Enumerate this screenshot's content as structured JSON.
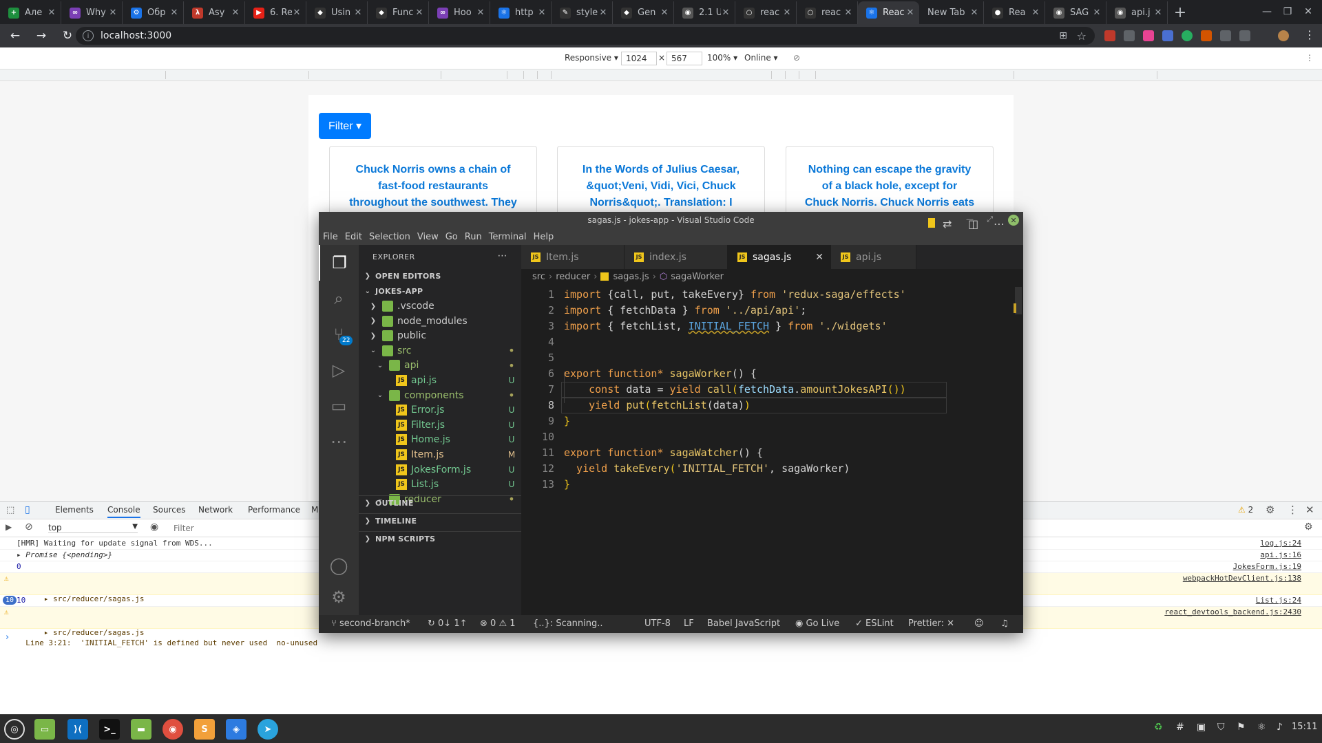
{
  "browser": {
    "tabs": [
      {
        "title": "Але",
        "color": "#1e8e3e",
        "glyph": "+"
      },
      {
        "title": "Why",
        "color": "#7b3fb5",
        "glyph": "∞"
      },
      {
        "title": "Обр",
        "color": "#1a73e8",
        "glyph": "⚙"
      },
      {
        "title": "Asy",
        "color": "#c0392b",
        "glyph": "λ"
      },
      {
        "title": "6. Re",
        "color": "#e62117",
        "glyph": "▶"
      },
      {
        "title": "Usin",
        "color": "#333",
        "glyph": "◆"
      },
      {
        "title": "Func",
        "color": "#333",
        "glyph": "◆"
      },
      {
        "title": "Hoo",
        "color": "#7b3fb5",
        "glyph": "∞"
      },
      {
        "title": "http",
        "color": "#1a73e8",
        "glyph": "⚛"
      },
      {
        "title": "style",
        "color": "#333",
        "glyph": "✎"
      },
      {
        "title": "Gen",
        "color": "#333",
        "glyph": "◆"
      },
      {
        "title": "2.1 U",
        "color": "#555",
        "glyph": "◉"
      },
      {
        "title": "reac",
        "color": "#333",
        "glyph": "○"
      },
      {
        "title": "reac",
        "color": "#333",
        "glyph": "○"
      },
      {
        "title": "Reac",
        "color": "#1a73e8",
        "glyph": "⚛",
        "active": true
      },
      {
        "title": "New Tab",
        "color": "",
        "glyph": ""
      },
      {
        "title": "Rea",
        "color": "#333",
        "glyph": "●"
      },
      {
        "title": "SAG",
        "color": "#555",
        "glyph": "◉"
      },
      {
        "title": "api.j",
        "color": "#555",
        "glyph": "◉"
      }
    ],
    "url": "localhost:3000"
  },
  "device_toolbar": {
    "mode": "Responsive",
    "width": "1024",
    "height": "567",
    "zoom": "100%",
    "throttle": "Online"
  },
  "page": {
    "filter_label": "Filter",
    "jokes": [
      "Chuck Norris owns a chain of fast-food restaurants throughout the southwest. They",
      "In the Words of Julius Caesar, &quot;Veni, Vidi, Vici, Chuck Norris&quot;. Translation: I",
      "Nothing can escape the gravity of a black hole, except for Chuck Norris. Chuck Norris eats"
    ]
  },
  "devtools": {
    "tabs": [
      "Elements",
      "Console",
      "Sources",
      "Network",
      "Performance",
      "M"
    ],
    "active_tab": "Console",
    "context": "top",
    "filter_placeholder": "Filter",
    "warning_count": "2",
    "console": [
      {
        "text": "[HMR] Waiting for update signal from WDS...",
        "source": "log.js:24",
        "type": "log"
      },
      {
        "text": "▸ Promise {<pending>}",
        "source": "api.js:16",
        "type": "log"
      },
      {
        "text": "0",
        "source": "JokesForm.js:19",
        "type": "num"
      },
      {
        "text": "▸ src/reducer/sagas.js\n  Line 3:21:  'INITIAL_FETCH' is defined but never used  no-unused",
        "source": "webpackHotDevClient.js:138",
        "type": "warn"
      },
      {
        "text": "10",
        "source": "List.js:24",
        "type": "count",
        "count": "10"
      },
      {
        "text": "▸ src/reducer/sagas.js\n  Line 3:21:  'INITIAL_FETCH' is defined but never used  no-unused",
        "source": "react_devtools_backend.js:2430",
        "type": "warn"
      }
    ]
  },
  "vscode": {
    "title": "sagas.js - jokes-app - Visual Studio Code",
    "menu": [
      "File",
      "Edit",
      "Selection",
      "View",
      "Go",
      "Run",
      "Terminal",
      "Help"
    ],
    "scm_badge": "22",
    "explorer_label": "EXPLORER",
    "sections": {
      "open_editors": "OPEN EDITORS",
      "project": "JOKES-APP",
      "outline": "OUTLINE",
      "timeline": "TIMELINE",
      "npm": "NPM SCRIPTS"
    },
    "tree": [
      {
        "name": ".vscode",
        "depth": 1,
        "kind": "folder",
        "open": false,
        "status": ""
      },
      {
        "name": "node_modules",
        "depth": 1,
        "kind": "folder",
        "open": false,
        "status": ""
      },
      {
        "name": "public",
        "depth": 1,
        "kind": "folder",
        "open": false,
        "status": ""
      },
      {
        "name": "src",
        "depth": 1,
        "kind": "folder",
        "open": true,
        "status": "•"
      },
      {
        "name": "api",
        "depth": 2,
        "kind": "folder",
        "open": true,
        "status": "•"
      },
      {
        "name": "api.js",
        "depth": 3,
        "kind": "js",
        "status": "U"
      },
      {
        "name": "components",
        "depth": 2,
        "kind": "folder",
        "open": true,
        "status": "•"
      },
      {
        "name": "Error.js",
        "depth": 3,
        "kind": "js",
        "status": "U"
      },
      {
        "name": "Filter.js",
        "depth": 3,
        "kind": "js",
        "status": "U"
      },
      {
        "name": "Home.js",
        "depth": 3,
        "kind": "js",
        "status": "U"
      },
      {
        "name": "Item.js",
        "depth": 3,
        "kind": "js",
        "status": "M"
      },
      {
        "name": "JokesForm.js",
        "depth": 3,
        "kind": "js",
        "status": "U"
      },
      {
        "name": "List.js",
        "depth": 3,
        "kind": "js",
        "status": "U"
      },
      {
        "name": "reducer",
        "depth": 2,
        "kind": "folder",
        "open": true,
        "status": "•"
      }
    ],
    "editor_tabs": [
      {
        "name": "Item.js",
        "active": false
      },
      {
        "name": "index.js",
        "active": false
      },
      {
        "name": "sagas.js",
        "active": true
      },
      {
        "name": "api.js",
        "active": false
      }
    ],
    "breadcrumbs": [
      "src",
      "reducer",
      "sagas.js",
      "sagaWorker"
    ],
    "code": [
      [
        {
          "t": "import ",
          "c": "k"
        },
        {
          "t": "{call, put, takeEvery} ",
          "c": "p"
        },
        {
          "t": "from ",
          "c": "k"
        },
        {
          "t": "'redux-saga/effects'",
          "c": "s"
        }
      ],
      [
        {
          "t": "import ",
          "c": "k"
        },
        {
          "t": "{ fetchData } ",
          "c": "p"
        },
        {
          "t": "from ",
          "c": "k"
        },
        {
          "t": "'../api/api'",
          "c": "s"
        },
        {
          "t": ";",
          "c": "p"
        }
      ],
      [
        {
          "t": "import ",
          "c": "k"
        },
        {
          "t": "{ fetchList, ",
          "c": "p"
        },
        {
          "t": "INITIAL_FETCH",
          "c": "c"
        },
        {
          "t": " } ",
          "c": "p"
        },
        {
          "t": "from ",
          "c": "k"
        },
        {
          "t": "'./widgets'",
          "c": "s"
        }
      ],
      [],
      [],
      [
        {
          "t": "export ",
          "c": "k"
        },
        {
          "t": "function* ",
          "c": "k"
        },
        {
          "t": "sagaWorker",
          "c": "f"
        },
        {
          "t": "() {",
          "c": "p"
        }
      ],
      [
        {
          "t": "    const ",
          "c": "k"
        },
        {
          "t": "data ",
          "c": "p"
        },
        {
          "t": "= ",
          "c": "p"
        },
        {
          "t": "yield ",
          "c": "k"
        },
        {
          "t": "call",
          "c": "f"
        },
        {
          "t": "(",
          "c": "y"
        },
        {
          "t": "fetchData",
          "c": "v"
        },
        {
          "t": ".",
          "c": "p"
        },
        {
          "t": "amountJokesAPI",
          "c": "f"
        },
        {
          "t": "())",
          "c": "y"
        }
      ],
      [
        {
          "t": "    yield ",
          "c": "k"
        },
        {
          "t": "put",
          "c": "f"
        },
        {
          "t": "(",
          "c": "y"
        },
        {
          "t": "fetchList",
          "c": "f"
        },
        {
          "t": "(data)",
          "c": "p"
        },
        {
          "t": ")",
          "c": "y"
        }
      ],
      [
        {
          "t": "}",
          "c": "y"
        }
      ],
      [],
      [
        {
          "t": "export ",
          "c": "k"
        },
        {
          "t": "function* ",
          "c": "k"
        },
        {
          "t": "sagaWatcher",
          "c": "f"
        },
        {
          "t": "() {",
          "c": "p"
        }
      ],
      [
        {
          "t": "  yield ",
          "c": "k"
        },
        {
          "t": "takeEvery",
          "c": "f"
        },
        {
          "t": "(",
          "c": "y"
        },
        {
          "t": "'INITIAL_FETCH'",
          "c": "s"
        },
        {
          "t": ", sagaWorker)",
          "c": "p"
        }
      ],
      [
        {
          "t": "}",
          "c": "y"
        }
      ]
    ],
    "status": {
      "branch": "second-branch*",
      "sync": "0↓ 1↑",
      "errors": "0",
      "warnings": "1",
      "scanning": "{..}: Scanning..",
      "encoding": "UTF-8",
      "eol": "LF",
      "language": "Babel JavaScript",
      "golive": "Go Live",
      "eslint": "ESLint",
      "prettier": "Prettier:"
    }
  },
  "taskbar": {
    "clock": "15:11"
  }
}
